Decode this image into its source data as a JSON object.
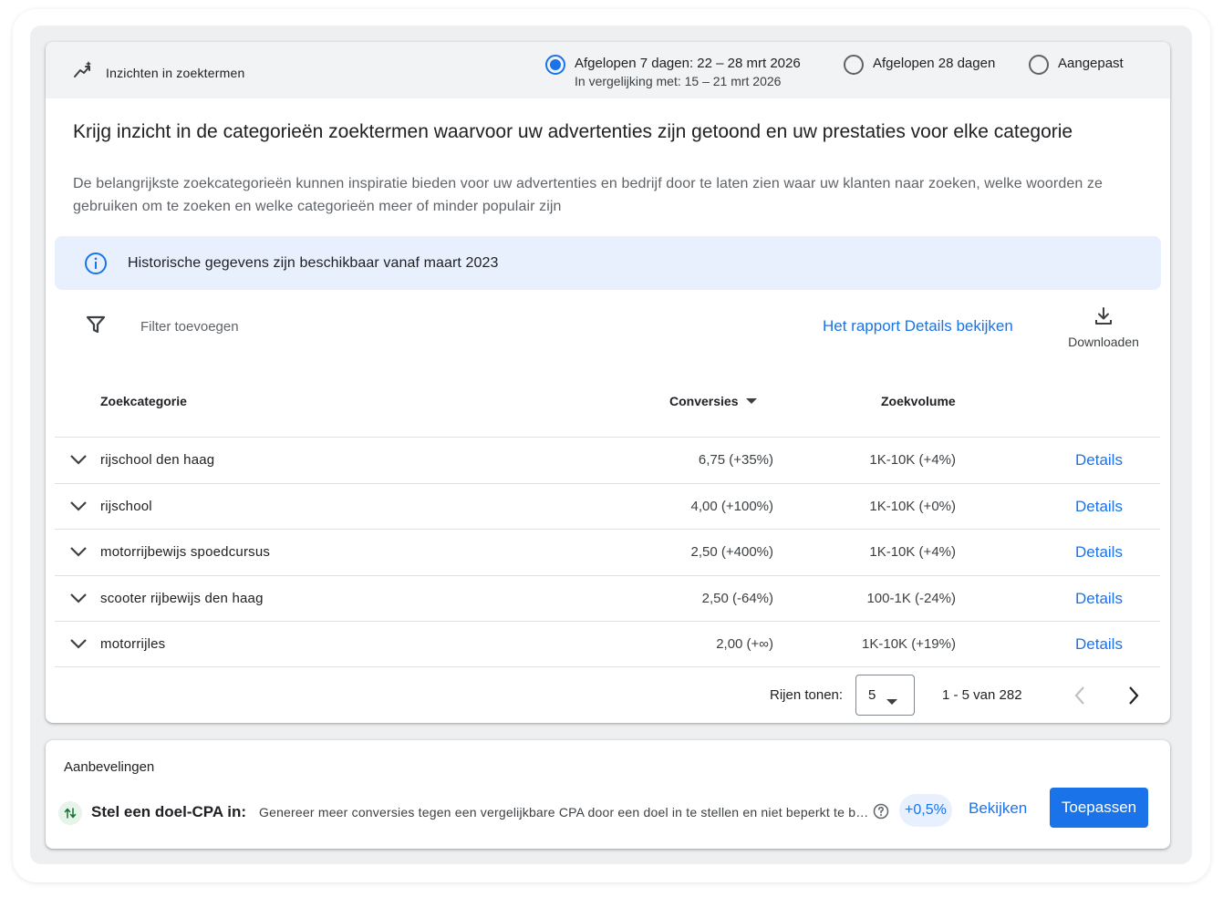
{
  "header": {
    "title": "Inzichten in zoektermen",
    "icon": "trending-sparkle-icon",
    "date_options": [
      {
        "label": "Afgelopen 7 dagen: 22 – 28 mrt 2026",
        "sub": "In vergelijking met: 15 – 21 mrt 2026",
        "selected": true
      },
      {
        "label": "Afgelopen 28 dagen",
        "selected": false
      },
      {
        "label": "Aangepast",
        "selected": false
      }
    ]
  },
  "intro": {
    "headline": "Krijg inzicht in de categorieën zoektermen waarvoor uw advertenties zijn getoond en uw prestaties voor elke categorie",
    "description": "De belangrijkste zoekcategorieën kunnen inspiratie bieden voor uw advertenties en bedrijf door te laten zien waar uw klanten naar zoeken, welke woorden ze gebruiken om te zoeken en welke categorieën meer of minder populair zijn"
  },
  "banner": {
    "text": "Historische gegevens zijn beschikbaar vanaf maart 2023",
    "icon": "info-icon"
  },
  "toolbar": {
    "filter_placeholder": "Filter toevoegen",
    "report_link": "Het rapport Details bekijken",
    "download_label": "Downloaden"
  },
  "table": {
    "columns": {
      "category": "Zoekcategorie",
      "conversions": "Conversies",
      "volume": "Zoekvolume"
    },
    "sort_column": "conversions",
    "sort_direction": "descending",
    "rows": [
      {
        "category": "rijschool den haag",
        "conversions": "6,75 (+35%)",
        "volume": "1K-10K (+4%)",
        "action": "Details"
      },
      {
        "category": "rijschool",
        "conversions": "4,00 (+100%)",
        "volume": "1K-10K (+0%)",
        "action": "Details"
      },
      {
        "category": "motorrijbewijs spoedcursus",
        "conversions": "2,50 (+400%)",
        "volume": "1K-10K (+4%)",
        "action": "Details"
      },
      {
        "category": "scooter rijbewijs den haag",
        "conversions": "2,50 (-64%)",
        "volume": "100-1K (-24%)",
        "action": "Details"
      },
      {
        "category": "motorrijles",
        "conversions": "2,00 (+∞)",
        "volume": "1K-10K (+19%)",
        "action": "Details"
      }
    ]
  },
  "pagination": {
    "rows_label": "Rijen tonen:",
    "rows_value": "5",
    "range": "1 - 5 van 282"
  },
  "recommendations": {
    "title": "Aanbevelingen",
    "item": {
      "name": "Stel een doel-CPA in:",
      "description": "Genereer meer conversies tegen een vergelijkbare CPA door een doel in te stellen en niet beperkt te blijven tot handmatige biedingen",
      "badge": "+0,5%",
      "view_label": "Bekijken",
      "apply_label": "Toepassen"
    }
  },
  "colors": {
    "accent": "#1a73e8",
    "header_bg": "#f1f3f4",
    "banner_bg": "#e8f0fe",
    "badge_bg": "#e8f0fe"
  }
}
